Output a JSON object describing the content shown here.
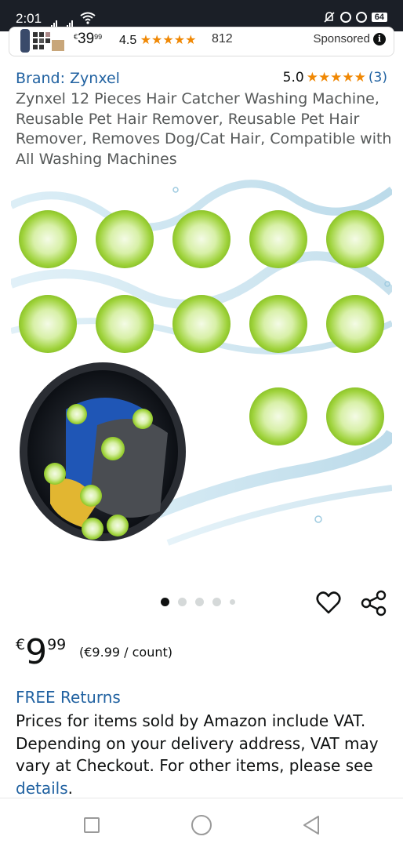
{
  "status_bar": {
    "time": "2:01",
    "battery": "64"
  },
  "sponsored_card": {
    "currency": "€",
    "price_whole": "39",
    "price_fraction": "99",
    "rating": "4.5",
    "stars": "★★★★★",
    "review_count": "812",
    "label": "Sponsored",
    "info_icon": "i"
  },
  "product": {
    "brand_label": "Brand: Zynxel",
    "rating_value": "5.0",
    "stars": "★★★★★",
    "review_count": "(3)",
    "title": "Zynxel 12 Pieces Hair Catcher Washing Machine, Reusable Pet Hair Remover, Reusable Pet Hair Remover, Removes Dog/Cat Hair, Compatible with All Washing Machines",
    "image_icon": "product-photo-hair-catcher-balls",
    "carousel": {
      "total": 5,
      "active": 0
    }
  },
  "price": {
    "currency": "€",
    "whole": "9",
    "fraction": "99",
    "unit_price": "(€9.99 / count)"
  },
  "returns": {
    "free_returns": "FREE Returns",
    "vat_text": "Prices for items sold by Amazon include VAT. Depending on your delivery address, VAT may vary at Checkout. For other items, please see ",
    "details_link": "details",
    "vat_end": "."
  },
  "colors": {
    "link": "#2162a1",
    "star": "#f08804",
    "ball_green": "#9ed23a"
  }
}
